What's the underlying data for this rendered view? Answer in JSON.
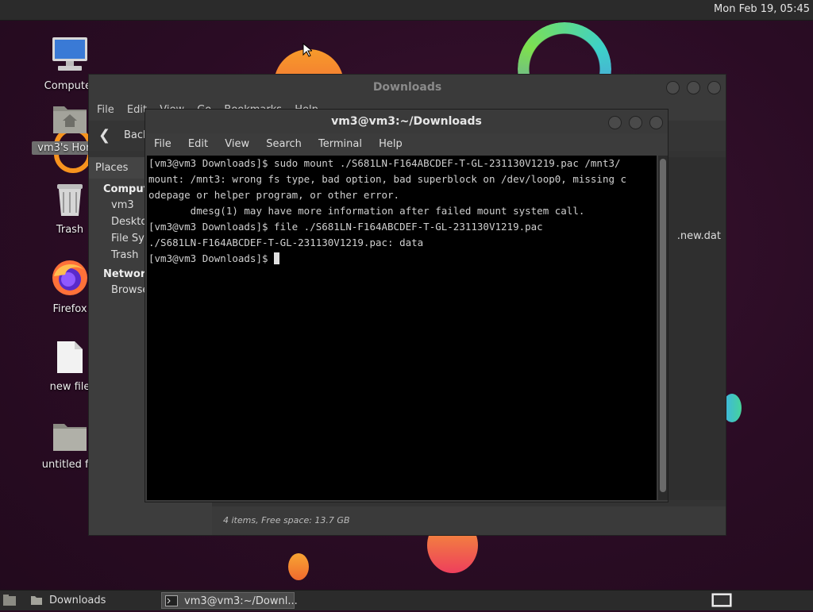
{
  "top_panel": {
    "clock": "Mon Feb 19, 05:45"
  },
  "desktop_icons": [
    {
      "label": "Computer",
      "icon": "computer-icon"
    },
    {
      "label": "vm3's Home",
      "icon": "home-folder-icon"
    },
    {
      "label": "Trash",
      "icon": "trash-icon"
    },
    {
      "label": "Firefox",
      "icon": "firefox-icon"
    },
    {
      "label": "new file",
      "icon": "file-icon"
    },
    {
      "label": "untitled fol",
      "icon": "folder-icon"
    }
  ],
  "file_manager": {
    "title": "Downloads",
    "menu": [
      "File",
      "Edit",
      "View",
      "Go",
      "Bookmarks",
      "Help"
    ],
    "back_label": "Back",
    "sidebar": {
      "header": "Places",
      "computer_label": "Computer",
      "items": [
        "vm3",
        "Desktop",
        "File System",
        "Trash"
      ],
      "network_label": "Network",
      "network_items": [
        "Browse Network"
      ]
    },
    "visible_file": ".new.dat",
    "status": "4 items, Free space: 13.7 GB"
  },
  "terminal": {
    "title": "vm3@vm3:~/Downloads",
    "menu": [
      "File",
      "Edit",
      "View",
      "Search",
      "Terminal",
      "Help"
    ],
    "lines": [
      "[vm3@vm3 Downloads]$ sudo mount ./S681LN-F164ABCDEF-T-GL-231130V1219.pac /mnt3/",
      "mount: /mnt3: wrong fs type, bad option, bad superblock on /dev/loop0, missing c",
      "odepage or helper program, or other error.",
      "       dmesg(1) may have more information after failed mount system call.",
      "[vm3@vm3 Downloads]$ file ./S681LN-F164ABCDEF-T-GL-231130V1219.pac",
      "./S681LN-F164ABCDEF-T-GL-231130V1219.pac: data"
    ],
    "prompt": "[vm3@vm3 Downloads]$ "
  },
  "taskbar": {
    "tasks": [
      "Downloads",
      "vm3@vm3:~/Downl..."
    ]
  }
}
